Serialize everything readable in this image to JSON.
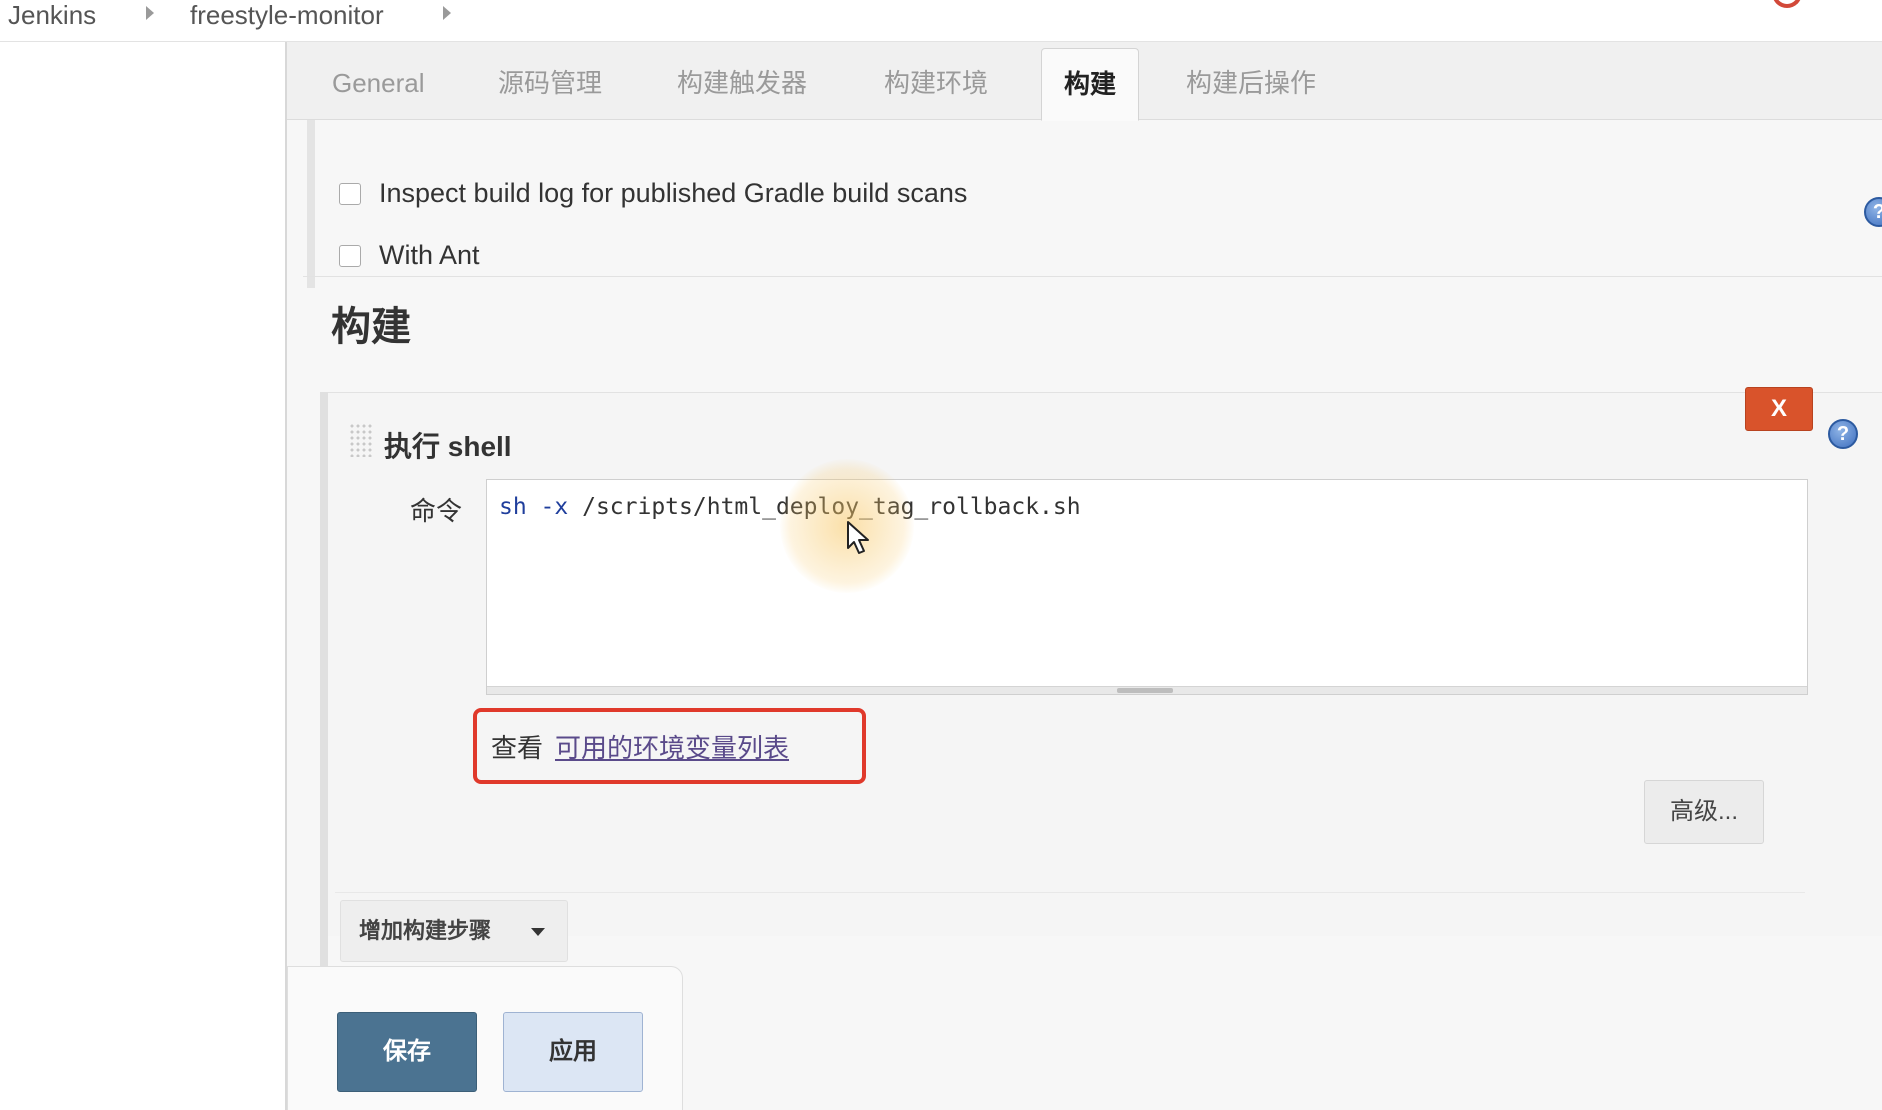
{
  "breadcrumb": {
    "items": [
      "Jenkins",
      "freestyle-monitor"
    ]
  },
  "tabs": [
    {
      "label": "General",
      "active": false
    },
    {
      "label": "源码管理",
      "active": false
    },
    {
      "label": "构建触发器",
      "active": false
    },
    {
      "label": "构建环境",
      "active": false
    },
    {
      "label": "构建",
      "active": true
    },
    {
      "label": "构建后操作",
      "active": false
    }
  ],
  "build_environment": {
    "options": [
      {
        "label": "Inspect build log for published Gradle build scans",
        "checked": false
      },
      {
        "label": "With Ant",
        "checked": false
      }
    ]
  },
  "build": {
    "section_title": "构建",
    "step": {
      "title": "执行 shell",
      "delete_label": "X",
      "command_label": "命令",
      "command_keyword": "sh -x",
      "command_rest": " /scripts/html_deploy_tag_rollback.sh",
      "env_prefix": "查看",
      "env_link": "可用的环境变量列表",
      "advanced_label": "高级..."
    },
    "add_step_label": "增加构建步骤"
  },
  "help_icon_label": "?",
  "actions": {
    "save_label": "保存",
    "apply_label": "应用"
  },
  "colors": {
    "delete": "#d9532b",
    "save": "#4b7391",
    "apply": "#dce6f4",
    "highlight": "#e0392b"
  },
  "icons": [
    "chevron-right-icon",
    "help-icon",
    "drag-handle-icon",
    "caret-down-icon",
    "mouse-cursor-icon"
  ]
}
